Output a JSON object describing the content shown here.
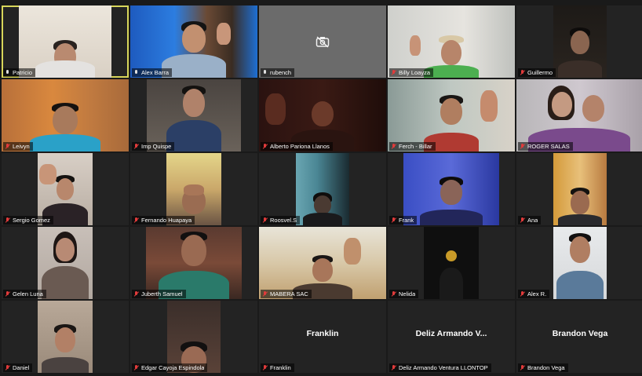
{
  "tiles": [
    {
      "name": "Patricio",
      "muted": false,
      "active": true
    },
    {
      "name": "Alex Barra",
      "muted": false
    },
    {
      "name": "rubench",
      "muted": false,
      "camera_off": true
    },
    {
      "name": "Billy Loayza",
      "muted": true
    },
    {
      "name": "Guillermo",
      "muted": true
    },
    {
      "name": "Leivyn",
      "muted": true
    },
    {
      "name": "Imp Quispe",
      "muted": true
    },
    {
      "name": "Alberto Pariona Llanos",
      "muted": true
    },
    {
      "name": "Ferch - Billar",
      "muted": true
    },
    {
      "name": "ROGER SALAS",
      "muted": true
    },
    {
      "name": "Sergio Gomez",
      "muted": true
    },
    {
      "name": "Fernando Huapaya",
      "muted": true
    },
    {
      "name": "Roosvel.S",
      "muted": true
    },
    {
      "name": "Frank",
      "muted": true
    },
    {
      "name": "Ana",
      "muted": true
    },
    {
      "name": "Gelen Luna",
      "muted": true
    },
    {
      "name": "Juberth Samuel",
      "muted": true
    },
    {
      "name": "MABERA SAC",
      "muted": true
    },
    {
      "name": "Nelida",
      "muted": true
    },
    {
      "name": "Alex R.",
      "muted": true
    },
    {
      "name": "Daniel",
      "muted": true
    },
    {
      "name": "Edgar Cayoja Espindola",
      "muted": true
    },
    {
      "name": "Franklin",
      "muted": true,
      "video_off": true,
      "big_label": "Franklin"
    },
    {
      "name": "Deliz Armando Ventura LLONTOP",
      "muted": true,
      "video_off": true,
      "big_label": "Deliz Armando V..."
    },
    {
      "name": "Brandon Vega",
      "muted": true,
      "video_off": true,
      "big_label": "Brandon Vega"
    }
  ],
  "colors": {
    "active_speaker_border": "#d8d65a",
    "muted_mic": "#e23b3b",
    "background": "#1a1a1a"
  },
  "icons": {
    "camera_off": "camera-off-icon",
    "mic": "microphone-icon",
    "mic_muted": "microphone-muted-icon"
  }
}
